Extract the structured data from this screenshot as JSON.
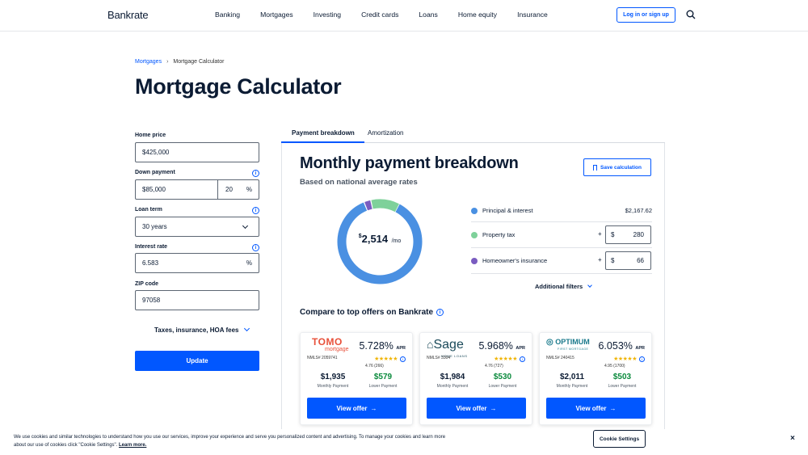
{
  "header": {
    "logo": "Bankrate",
    "nav": [
      "Banking",
      "Mortgages",
      "Investing",
      "Credit cards",
      "Loans",
      "Home equity",
      "Insurance"
    ],
    "login_label": "Log in or sign up"
  },
  "breadcrumb": {
    "parent": "Mortgages",
    "current": "Mortgage Calculator"
  },
  "page_title": "Mortgage Calculator",
  "form": {
    "home_price_label": "Home price",
    "home_price_value": "$425,000",
    "down_payment_label": "Down payment",
    "down_payment_value": "$85,000",
    "down_payment_pct": "20",
    "pct_symbol": "%",
    "loan_term_label": "Loan term",
    "loan_term_value": "30 years",
    "interest_rate_label": "Interest rate",
    "interest_rate_value": "6.583",
    "zip_label": "ZIP code",
    "zip_value": "97058",
    "taxes_toggle": "Taxes, insurance, HOA fees",
    "update_label": "Update"
  },
  "tabs": {
    "active": "Payment breakdown",
    "inactive": "Amortization"
  },
  "breakdown": {
    "title": "Monthly payment breakdown",
    "subtitle": "Based on national average rates",
    "save_label": "Save calculation",
    "center_dollar": "$",
    "center_amount": "2,514",
    "center_unit": "/mo",
    "items": [
      {
        "label": "Principal & interest",
        "value": "$2,167.62",
        "color": "#4a90e2",
        "amount": 2167.62
      },
      {
        "label": "Property tax",
        "prefix": "$",
        "value": "280",
        "color": "#7ed19a",
        "amount": 280
      },
      {
        "label": "Homeowner's insurance",
        "prefix": "$",
        "value": "66",
        "color": "#7a5cc0",
        "amount": 66
      }
    ],
    "plus": "+",
    "additional_filters": "Additional filters"
  },
  "compare": {
    "title": "Compare to top offers on Bankrate",
    "offers": [
      {
        "logo": "TOMO mortgage",
        "nmls": "NMLS# 2059741",
        "apr": "5.728%",
        "apr_label": "APR",
        "rating": "4.76 (266)",
        "monthly": "$1,935",
        "monthly_label": "Monthly Payment",
        "lower": "$579",
        "lower_label": "Lower Payment",
        "cta": "View offer"
      },
      {
        "logo": "Sage HOME LOANS",
        "nmls": "NMLS# 3304",
        "apr": "5.968%",
        "apr_label": "APR",
        "rating": "4.76 (727)",
        "monthly": "$1,984",
        "monthly_label": "Monthly Payment",
        "lower": "$530",
        "lower_label": "Lower Payment",
        "cta": "View offer"
      },
      {
        "logo": "OPTIMUM FIRST MORTGAGE",
        "nmls": "NMLS# 240415",
        "apr": "6.053%",
        "apr_label": "APR",
        "rating": "4.95 (1700)",
        "monthly": "$2,011",
        "monthly_label": "Monthly Payment",
        "lower": "$503",
        "lower_label": "Lower Payment",
        "cta": "View offer"
      }
    ]
  },
  "cookie": {
    "text": "We use cookies and similar technologies to understand how you use our services, improve your experience and serve you personalized content and advertising. To manage your cookies and learn more about our use of cookies click \"Cookie Settings\".",
    "learn_more": "Learn more.",
    "settings_label": "Cookie Settings",
    "close": "×"
  },
  "icons": {
    "search": "search-icon",
    "info": "info-icon",
    "chevron": "chevron-down-icon",
    "bookmark": "bookmark-icon",
    "arrow": "arrow-right-icon",
    "close": "close-icon"
  },
  "colors": {
    "accent": "#0157ff",
    "green": "#0a8a3c"
  }
}
